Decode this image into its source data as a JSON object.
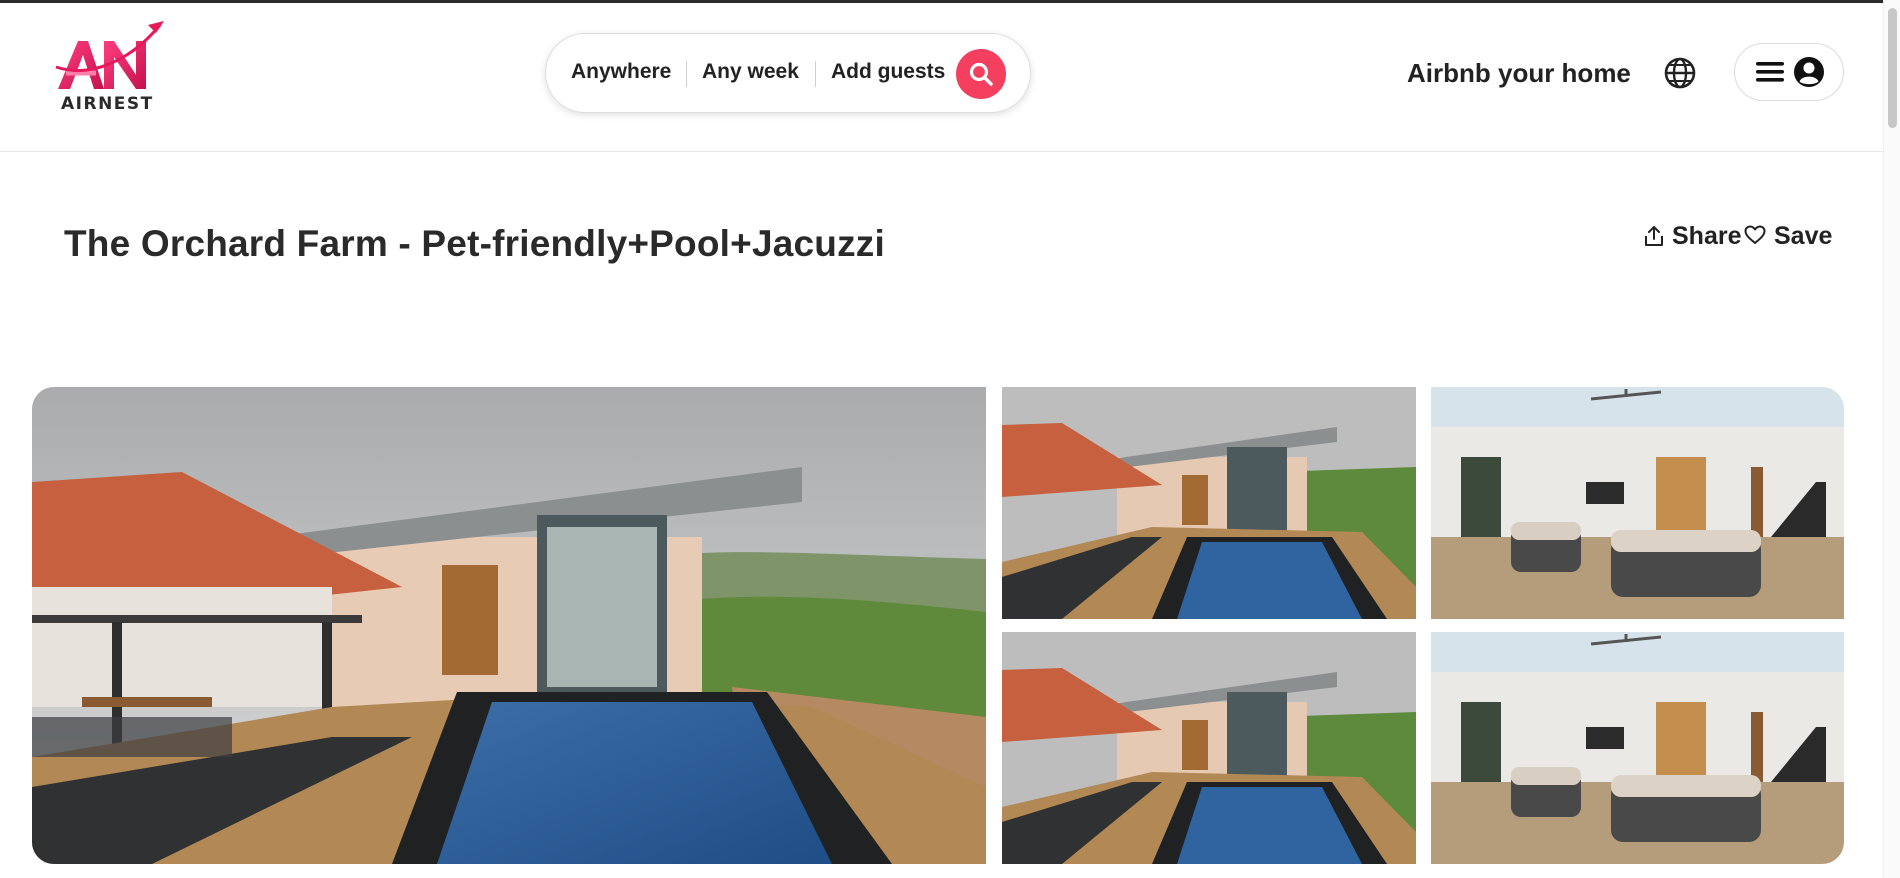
{
  "brand": {
    "name": "AIRNEST",
    "accent": "#e6195a"
  },
  "search": {
    "where": "Anywhere",
    "when": "Any week",
    "who": "Add guests",
    "button_color": "#f43f5e",
    "button_icon": "search-icon"
  },
  "nav": {
    "host_link": "Airbnb your home",
    "globe_icon": "globe-icon",
    "menu_icon": "hamburger-menu-icon",
    "avatar_icon": "user-circle-icon"
  },
  "listing": {
    "title": "The Orchard Farm - Pet-friendly+Pool+Jacuzzi",
    "share_label": "Share",
    "save_label": "Save"
  },
  "gallery": {
    "photos": [
      {
        "subject": "villa-exterior-pool"
      },
      {
        "subject": "villa-exterior-pool"
      },
      {
        "subject": "living-room-interior"
      },
      {
        "subject": "villa-exterior-pool"
      },
      {
        "subject": "living-room-interior"
      }
    ]
  }
}
